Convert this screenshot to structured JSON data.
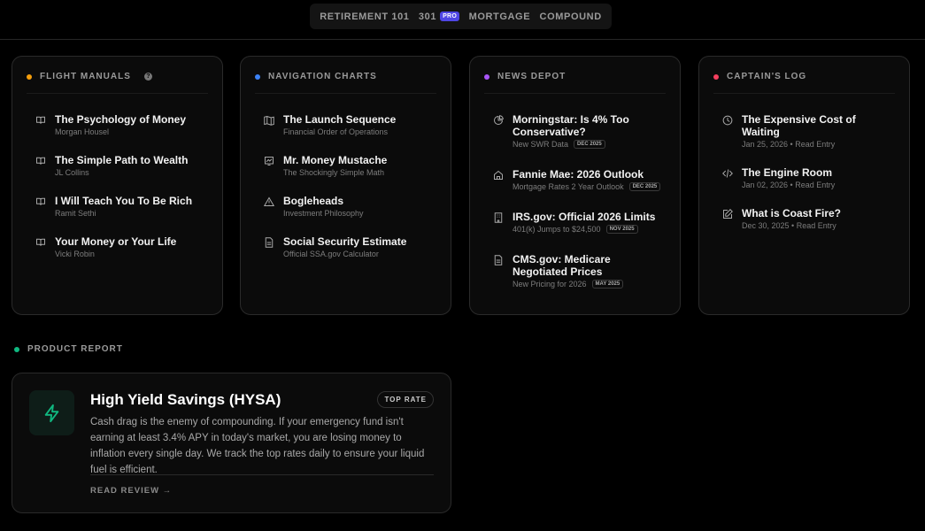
{
  "nav": {
    "items": [
      "RETIREMENT 101",
      "301",
      "MORTGAGE",
      "COMPOUND"
    ],
    "pro_badge": "PRO"
  },
  "cards": [
    {
      "title": "FLIGHT MANUALS",
      "color": "#f59e0b",
      "help": "?",
      "items": [
        {
          "icon": "book-icon",
          "title": "The Psychology of Money",
          "sub": "Morgan Housel"
        },
        {
          "icon": "book-icon",
          "title": "The Simple Path to Wealth",
          "sub": "JL Collins"
        },
        {
          "icon": "book-icon",
          "title": "I Will Teach You To Be Rich",
          "sub": "Ramit Sethi"
        },
        {
          "icon": "book-icon",
          "title": "Your Money or Your Life",
          "sub": "Vicki Robin"
        }
      ]
    },
    {
      "title": "NAVIGATION CHARTS",
      "color": "#3b82f6",
      "items": [
        {
          "icon": "map-icon",
          "title": "The Launch Sequence",
          "sub": "Financial Order of Operations"
        },
        {
          "icon": "chart-icon",
          "title": "Mr. Money Mustache",
          "sub": "The Shockingly Simple Math"
        },
        {
          "icon": "warning-icon",
          "title": "Bogleheads",
          "sub": "Investment Philosophy"
        },
        {
          "icon": "document-icon",
          "title": "Social Security Estimate",
          "sub": "Official SSA.gov Calculator"
        }
      ]
    },
    {
      "title": "NEWS DEPOT",
      "color": "#a855f7",
      "items": [
        {
          "icon": "pie-chart-icon",
          "title": "Morningstar: Is 4% Too Conservative?",
          "sub": "New SWR Data",
          "badge": "DEC 2025"
        },
        {
          "icon": "home-icon",
          "title": "Fannie Mae: 2026 Outlook",
          "sub": "Mortgage Rates 2 Year Outlook",
          "badge": "DEC 2025"
        },
        {
          "icon": "building-icon",
          "title": "IRS.gov: Official 2026 Limits",
          "sub": "401(k) Jumps to $24,500",
          "badge": "NOV 2025"
        },
        {
          "icon": "document-icon",
          "title": "CMS.gov: Medicare Negotiated Prices",
          "sub": "New Pricing for 2026",
          "badge": "MAY 2025"
        }
      ]
    },
    {
      "title": "CAPTAIN'S LOG",
      "color": "#f43f5e",
      "items": [
        {
          "icon": "clock-icon",
          "title": "The Expensive Cost of Waiting",
          "sub": "Jan 25, 2026 • Read Entry"
        },
        {
          "icon": "code-icon",
          "title": "The Engine Room",
          "sub": "Jan 02, 2026 • Read Entry"
        },
        {
          "icon": "edit-icon",
          "title": "What is Coast Fire?",
          "sub": "Dec 30, 2025 • Read Entry"
        }
      ]
    }
  ],
  "product": {
    "section": "PRODUCT REPORT",
    "color": "#10b981",
    "title": "High Yield Savings (HYSA)",
    "badge": "TOP RATE",
    "description": "Cash drag is the enemy of compounding. If your emergency fund isn't earning at least 3.4% APY in today's market, you are losing money to inflation every single day. We track the top rates daily to ensure your liquid fuel is efficient.",
    "cta": "READ REVIEW →"
  }
}
